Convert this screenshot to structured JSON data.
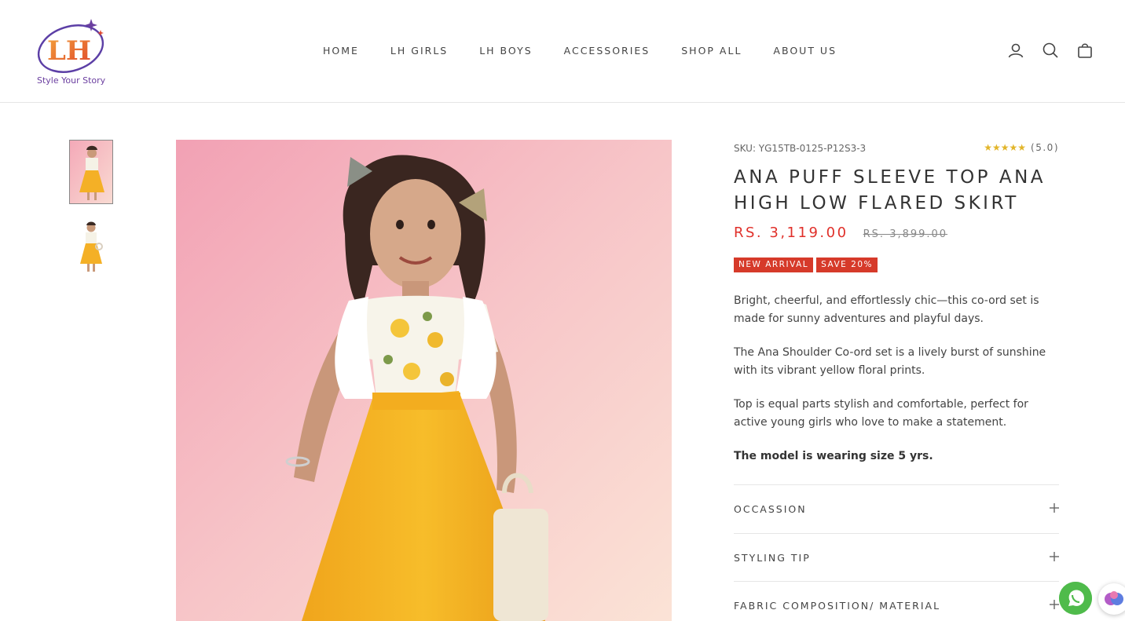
{
  "header": {
    "logo_text": "LH",
    "logo_tagline": "Style Your Story",
    "nav": [
      {
        "label": "HOME"
      },
      {
        "label": "LH GIRLS"
      },
      {
        "label": "LH BOYS"
      },
      {
        "label": "ACCESSORIES"
      },
      {
        "label": "SHOP ALL"
      },
      {
        "label": "ABOUT US"
      }
    ],
    "icons": [
      "account-icon",
      "search-icon",
      "cart-icon"
    ]
  },
  "gallery": {
    "thumbnails": [
      "thumbnail-1",
      "thumbnail-2"
    ]
  },
  "product": {
    "sku": "SKU: YG15TB-0125-P12S3-3",
    "rating_stars": "★★★★★",
    "rating_value": "(5.0)",
    "title": "ANA PUFF SLEEVE TOP ANA HIGH LOW FLARED SKIRT",
    "price": "RS. 3,119.00",
    "compare_price": "RS. 3,899.00",
    "badges": [
      "NEW ARRIVAL",
      "SAVE 20%"
    ],
    "description": [
      "Bright, cheerful, and effortlessly chic—this co-ord set is made for sunny adventures and playful days.",
      "The Ana Shoulder Co-ord set is a lively burst of sunshine with its vibrant yellow floral prints.",
      "Top is equal parts stylish and comfortable, perfect for active young girls who love to make a statement.",
      "The model is wearing size 5 yrs."
    ],
    "accordions": [
      {
        "label": "OCCASSION"
      },
      {
        "label": "STYLING TIP"
      },
      {
        "label": "FABRIC COMPOSITION/ MATERIAL"
      }
    ]
  },
  "colors": {
    "accent_price": "#e0302a",
    "badge": "#d63a2a",
    "whatsapp": "#4fbb4b",
    "star": "#e2b52a"
  }
}
